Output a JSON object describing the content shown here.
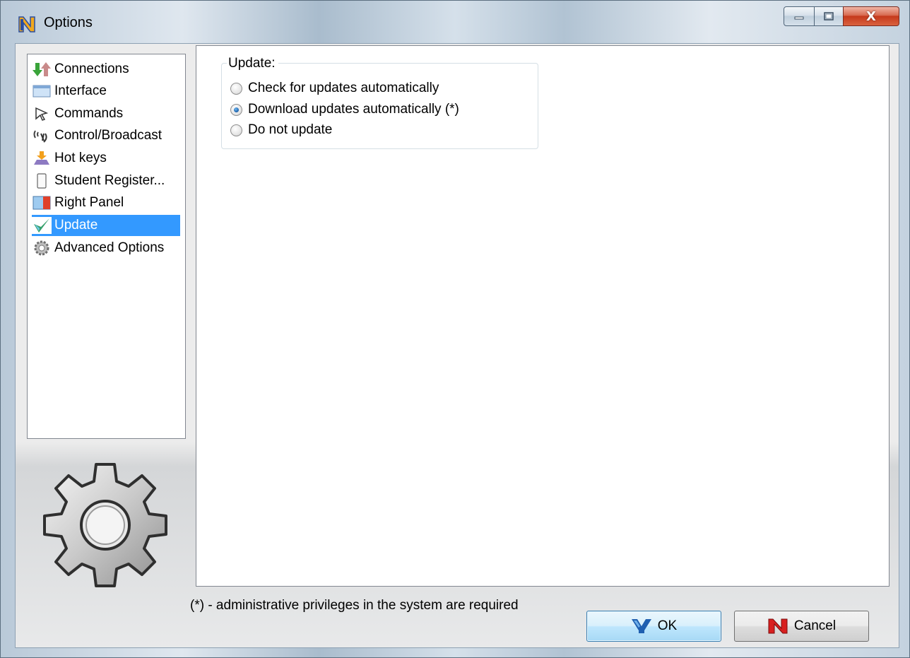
{
  "window": {
    "title": "Options",
    "minimize_glyph": "–",
    "maximize_glyph": "□",
    "close_glyph": "X"
  },
  "nav": {
    "items": [
      {
        "label": "Connections",
        "icon": "connections-arrows-icon"
      },
      {
        "label": "Interface",
        "icon": "window-icon"
      },
      {
        "label": "Commands",
        "icon": "cursor-icon"
      },
      {
        "label": "Control/Broadcast",
        "icon": "broadcast-icon"
      },
      {
        "label": "Hot keys",
        "icon": "hotkeys-icon"
      },
      {
        "label": "Student Register...",
        "icon": "phone-icon"
      },
      {
        "label": "Right Panel",
        "icon": "panel-icon"
      },
      {
        "label": "Update",
        "icon": "checkmark-icon",
        "selected": true
      },
      {
        "label": "Advanced Options",
        "icon": "gear-icon"
      }
    ]
  },
  "update_group": {
    "title": "Update:",
    "options": [
      {
        "label": "Check for updates automatically",
        "checked": false
      },
      {
        "label": "Download updates automatically (*)",
        "checked": true
      },
      {
        "label": "Do not update",
        "checked": false
      }
    ]
  },
  "footnote": "(*) - administrative privileges in the system are required",
  "buttons": {
    "ok": "OK",
    "cancel": "Cancel"
  },
  "colors": {
    "selection": "#3399ff",
    "close_button": "#c5391c"
  }
}
